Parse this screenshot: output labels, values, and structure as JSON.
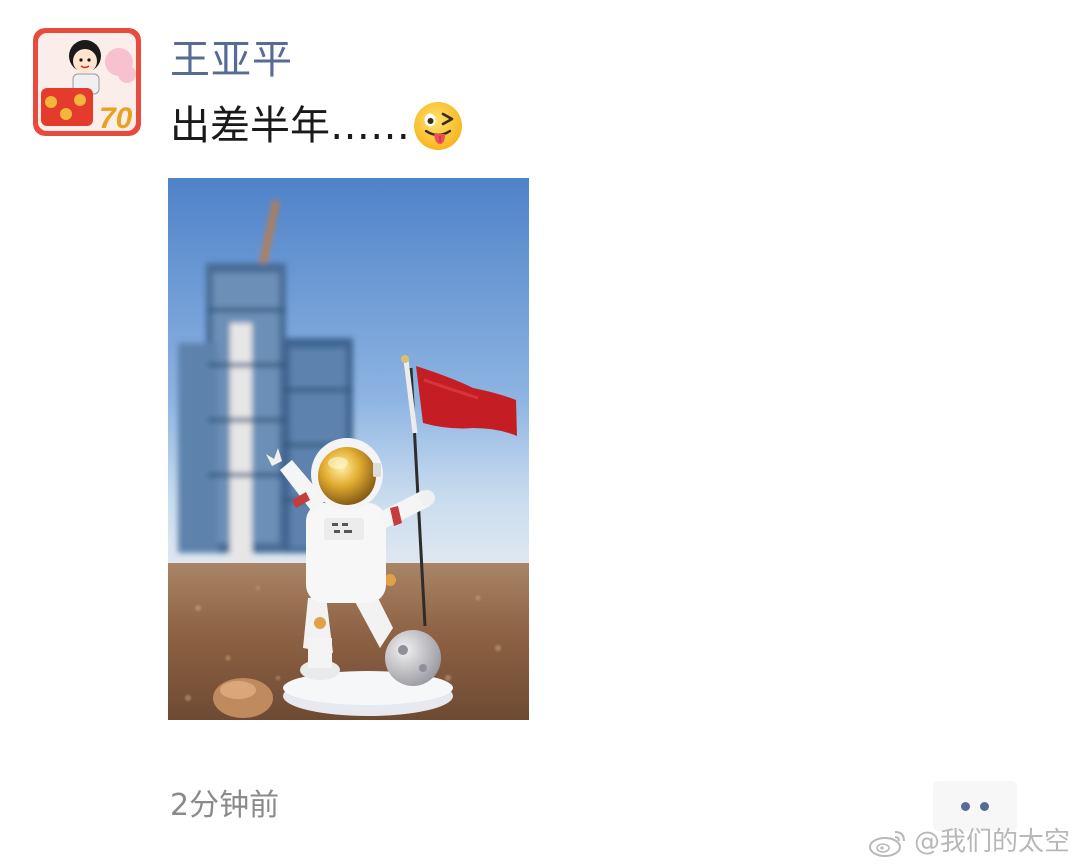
{
  "post": {
    "author_name": "王亚平",
    "text": "出差半年……",
    "emoji": "winking-tongue-face-emoji",
    "timestamp": "2分钟前",
    "avatar_badge_text": "70"
  },
  "actions": {
    "more_icon": "two-dots-more-icon"
  },
  "watermark": {
    "icon": "weibo-logo-icon",
    "text": "@我们的太空"
  },
  "colors": {
    "author_name": "#576b95",
    "more_dots": "#576b95",
    "timestamp": "#8a8a8a",
    "watermark": "#b8b8b8",
    "avatar_border": "#e84a3c"
  }
}
